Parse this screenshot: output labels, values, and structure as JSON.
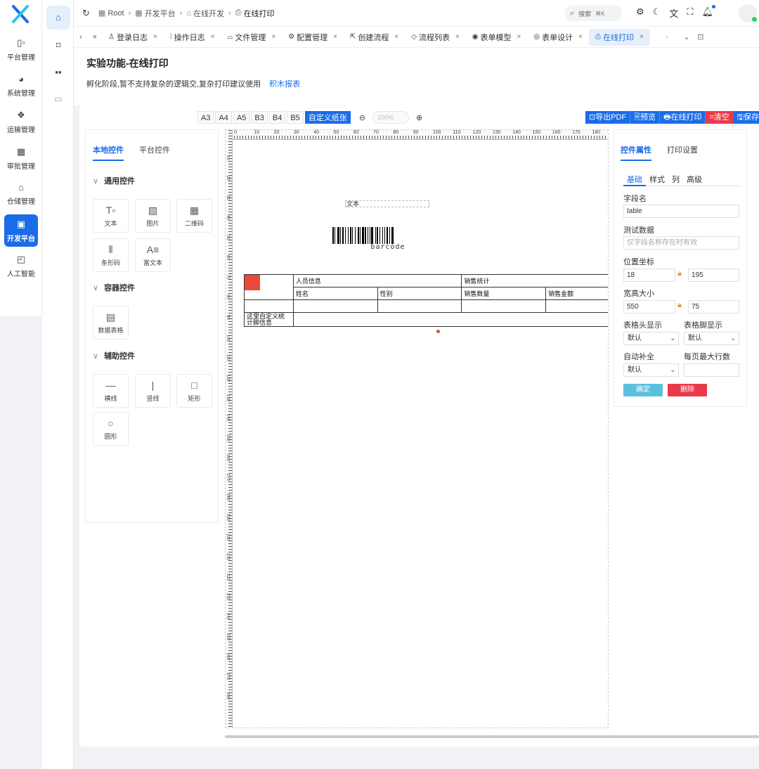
{
  "sidebar": {
    "items": [
      {
        "label": "平台管理",
        "icon": "platform-icon"
      },
      {
        "label": "系统管理",
        "icon": "system-icon"
      },
      {
        "label": "运输管理",
        "icon": "transport-icon"
      },
      {
        "label": "审批管理",
        "icon": "approval-icon"
      },
      {
        "label": "仓储管理",
        "icon": "warehouse-icon"
      },
      {
        "label": "开发平台",
        "icon": "devplatform-icon",
        "active": true
      },
      {
        "label": "人工智能",
        "icon": "ai-icon"
      }
    ]
  },
  "breadcrumb": {
    "items": [
      "Root",
      "开发平台",
      "在线开发",
      "在线打印"
    ]
  },
  "search": {
    "placeholder": "搜索",
    "shortcut": "⌘K"
  },
  "tabs": [
    {
      "label": "登录日志",
      "icon": "login-log-icon"
    },
    {
      "label": "操作日志",
      "icon": "operation-log-icon"
    },
    {
      "label": "文件管理",
      "icon": "file-icon"
    },
    {
      "label": "配置管理",
      "icon": "config-icon"
    },
    {
      "label": "创建流程",
      "icon": "create-flow-icon"
    },
    {
      "label": "流程列表",
      "icon": "flow-list-icon"
    },
    {
      "label": "表单模型",
      "icon": "form-model-icon"
    },
    {
      "label": "表单设计",
      "icon": "form-design-icon"
    },
    {
      "label": "在线打印",
      "icon": "print-icon",
      "active": true
    }
  ],
  "page": {
    "title": "实验功能-在线打印",
    "description": "孵化阶段,暂不支持复杂的逻辑交,复杂打印建议使用",
    "link": "积木报表"
  },
  "toolbar": {
    "paper_sizes": [
      "A3",
      "A4",
      "A5",
      "B3",
      "B4",
      "B5",
      "自定义纸张"
    ],
    "active_paper": "自定义纸张",
    "zoom": "100%",
    "actions": [
      {
        "label": "⊡导出PDF",
        "color": "#1a6ce8"
      },
      {
        "label": "🖹预览",
        "color": "#1a6ce8"
      },
      {
        "label": "🖶在线打印",
        "color": "#1a6ce8"
      },
      {
        "label": "⌗清空",
        "color": "#e83a4a"
      },
      {
        "label": "🖫保存",
        "color": "#1a6ce8"
      }
    ]
  },
  "left_panel": {
    "tabs": [
      "本地控件",
      "平台控件"
    ],
    "groups": [
      {
        "title": "通用控件",
        "items": [
          "文本",
          "图片",
          "二维码",
          "条形码",
          "富文本"
        ]
      },
      {
        "title": "容器控件",
        "items": [
          "数据表格"
        ]
      },
      {
        "title": "辅助控件",
        "items": [
          "横线",
          "竖线",
          "矩形",
          "圆形"
        ]
      }
    ]
  },
  "canvas": {
    "ruler_labels": [
      "0",
      "10",
      "20",
      "30",
      "40",
      "50",
      "60",
      "70",
      "80",
      "90",
      "100",
      "110",
      "120",
      "130",
      "140",
      "150",
      "160",
      "170",
      "180"
    ],
    "vruler_labels": [
      "10",
      "20",
      "30",
      "40",
      "50",
      "60",
      "70",
      "80",
      "90",
      "100",
      "110",
      "120",
      "130",
      "140",
      "150",
      "160",
      "170",
      "180",
      "190",
      "200",
      "210",
      "220",
      "230",
      "240",
      "250",
      "260",
      "270",
      "280"
    ],
    "text_element": "文本",
    "barcode_text": "barcode",
    "table": {
      "header_row1": [
        "人员信息",
        "销售统计"
      ],
      "header_row2": [
        "姓名",
        "性别",
        "销售数量",
        "销售金额"
      ],
      "footer_text": "这里自定义统计脚信息"
    }
  },
  "right_panel": {
    "tabs": [
      "控件属性",
      "打印设置"
    ],
    "subtabs": [
      "基础",
      "样式",
      "列",
      "高级"
    ],
    "field_name_label": "字段名",
    "field_name_value": "table",
    "test_data_label": "测试数据",
    "test_data_placeholder": "仅字段名称存在时有效",
    "position_label": "位置坐标",
    "pos_x": "18",
    "pos_y": "195",
    "size_label": "宽高大小",
    "width": "550",
    "height": "75",
    "header_show_label": "表格头显示",
    "header_show_value": "默认",
    "footer_show_label": "表格脚显示",
    "footer_show_value": "默认",
    "autofill_label": "自动补全",
    "autofill_value": "默认",
    "max_rows_label": "每页最大行数",
    "max_rows_value": "",
    "confirm_label": "确定",
    "delete_label": "删除"
  },
  "colors": {
    "primary": "#1a6ce8",
    "danger": "#e83a4a",
    "confirm": "#5bc0de"
  }
}
